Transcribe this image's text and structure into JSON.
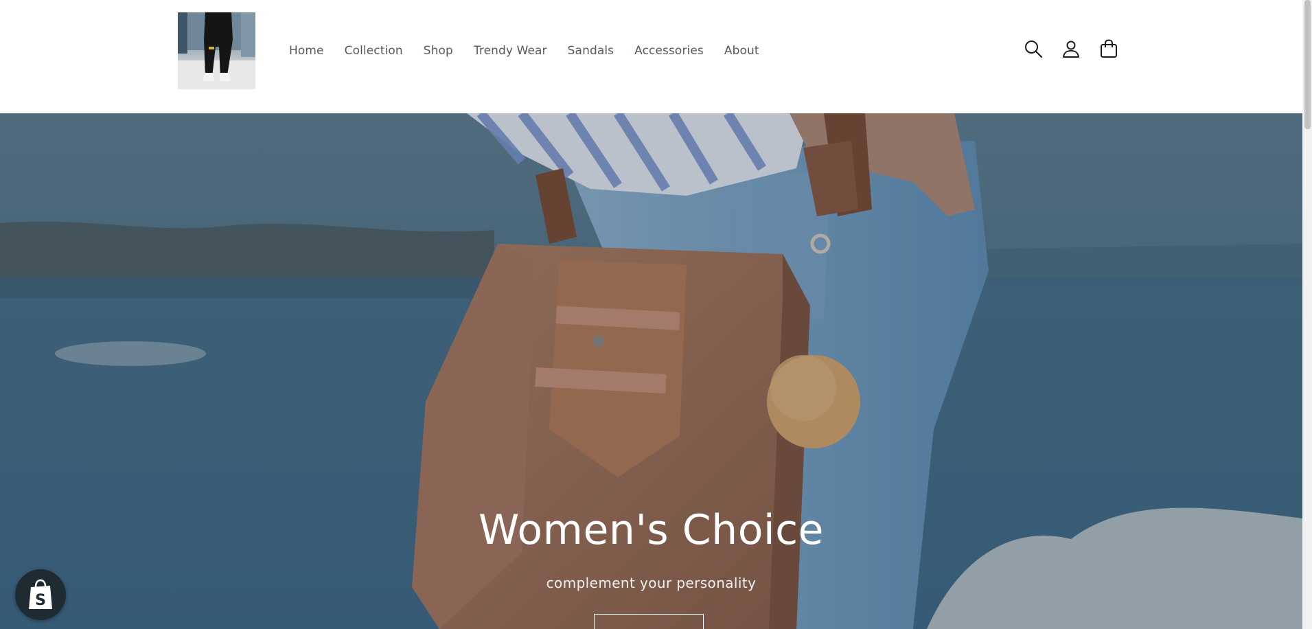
{
  "header": {
    "logo_alt": "store-logo",
    "nav": [
      {
        "label": "Home"
      },
      {
        "label": "Collection"
      },
      {
        "label": "Shop"
      },
      {
        "label": "Trendy Wear"
      },
      {
        "label": "Sandals"
      },
      {
        "label": "Accessories"
      },
      {
        "label": "About"
      }
    ],
    "icons": [
      "search-icon",
      "account-icon",
      "cart-icon"
    ]
  },
  "hero": {
    "title": "Women's Choice",
    "subtitle": "complement your personality",
    "button_label": ""
  },
  "widgets": {
    "shopify_badge_icon": "shopify-bag-icon"
  },
  "colors": {
    "nav_text": "#555b61",
    "hero_text": "#ffffff",
    "badge_bg": "#1f2b33"
  }
}
